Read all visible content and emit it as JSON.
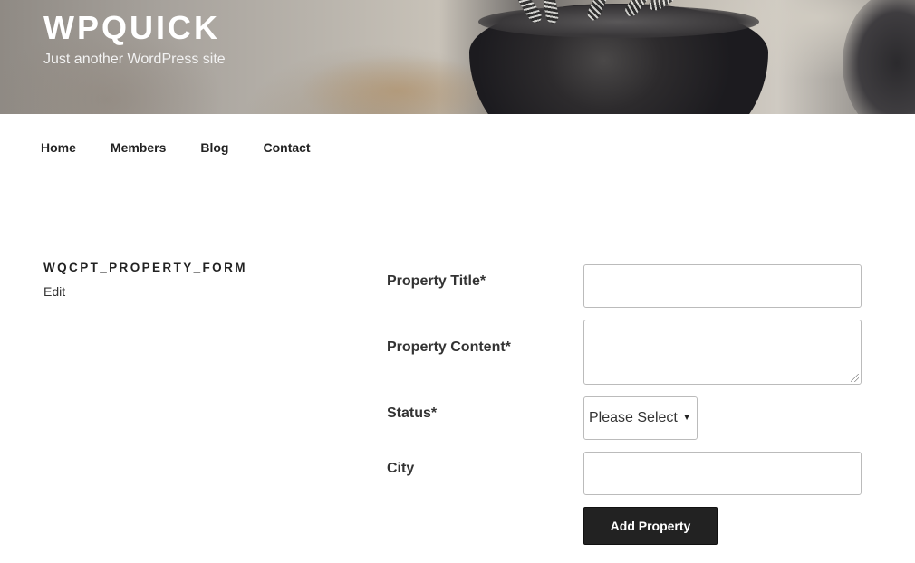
{
  "site": {
    "title": "WPQUICK",
    "description": "Just another WordPress site"
  },
  "nav": {
    "items": [
      {
        "label": "Home"
      },
      {
        "label": "Members"
      },
      {
        "label": "Blog"
      },
      {
        "label": "Contact"
      }
    ]
  },
  "page": {
    "title": "WQCPT_PROPERTY_FORM",
    "edit_label": "Edit"
  },
  "form": {
    "property_title_label": "Property Title*",
    "property_title_value": "",
    "property_content_label": "Property Content*",
    "property_content_value": "",
    "status_label": "Status*",
    "status_selected": "Please Select",
    "status_arrow": "▼",
    "city_label": "City",
    "city_value": "",
    "submit_label": "Add Property"
  },
  "colors": {
    "button_background": "#222222",
    "button_text": "#ffffff",
    "field_border": "#bbbbbb"
  }
}
